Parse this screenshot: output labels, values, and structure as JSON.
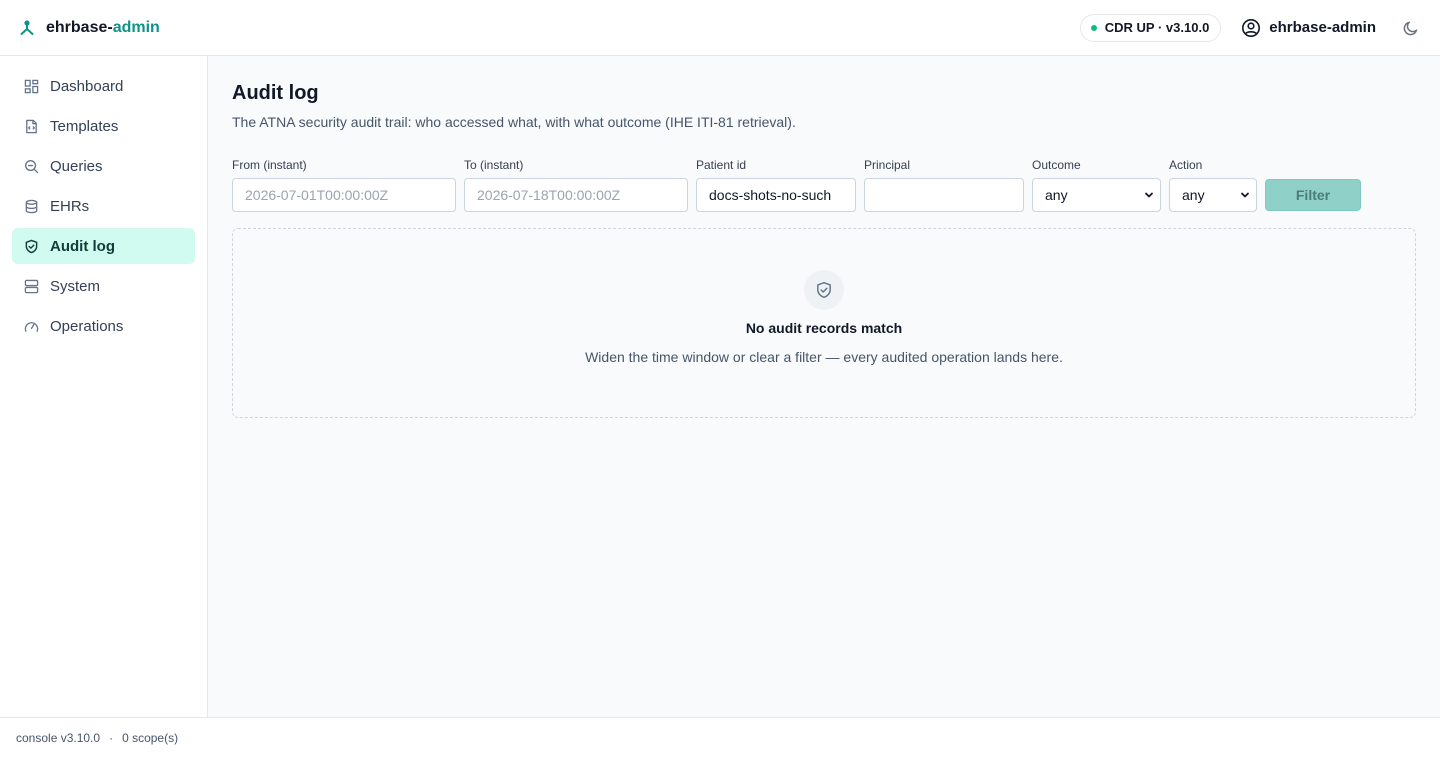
{
  "header": {
    "brand_prefix": "ehrbase-",
    "brand_suffix": "admin",
    "status": "CDR UP · v3.10.0",
    "user": "ehrbase-admin"
  },
  "sidebar": {
    "items": [
      {
        "label": "Dashboard",
        "icon": "dashboard-icon"
      },
      {
        "label": "Templates",
        "icon": "templates-icon"
      },
      {
        "label": "Queries",
        "icon": "queries-icon"
      },
      {
        "label": "EHRs",
        "icon": "database-icon"
      },
      {
        "label": "Audit log",
        "icon": "shield-icon",
        "active": true
      },
      {
        "label": "System",
        "icon": "server-icon"
      },
      {
        "label": "Operations",
        "icon": "gauge-icon"
      }
    ]
  },
  "main": {
    "title": "Audit log",
    "subtitle": "The ATNA security audit trail: who accessed what, with what outcome (IHE ITI-81 retrieval).",
    "filters": {
      "from_label": "From (instant)",
      "from_placeholder": "2026-07-01T00:00:00Z",
      "to_label": "To (instant)",
      "to_placeholder": "2026-07-18T00:00:00Z",
      "patient_label": "Patient id",
      "patient_value": "docs-shots-no-such",
      "principal_label": "Principal",
      "principal_value": "",
      "outcome_label": "Outcome",
      "outcome_value": "any",
      "action_label": "Action",
      "action_value": "any",
      "filter_button": "Filter"
    },
    "empty": {
      "title": "No audit records match",
      "text": "Widen the time window or clear a filter — every audited operation lands here."
    }
  },
  "footer": {
    "version": "console v3.10.0",
    "separator": "·",
    "scopes": "0 scope(s)"
  },
  "colors": {
    "accent": "#0d9488",
    "status_ok": "#10b981",
    "active_nav_bg": "#d1faf0"
  }
}
